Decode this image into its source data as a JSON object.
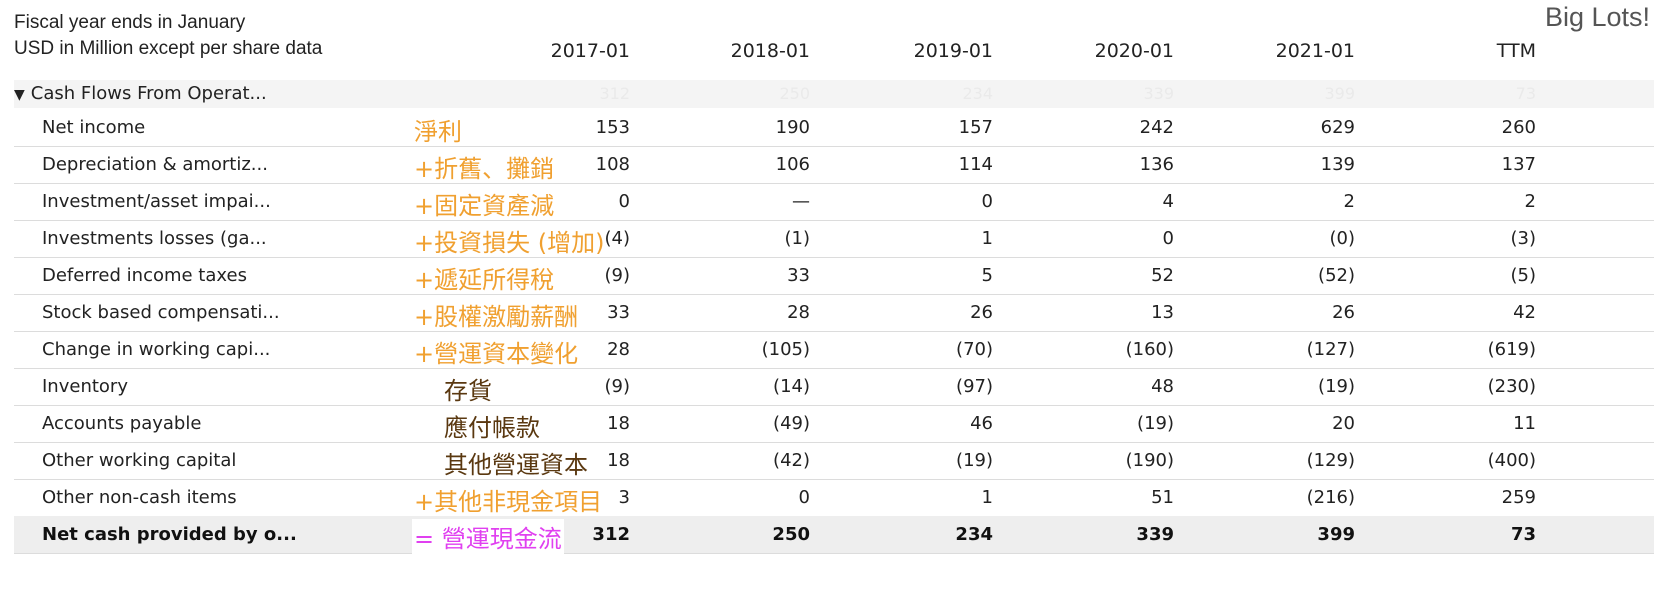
{
  "brand": "Big Lots!",
  "header": {
    "line1": "Fiscal year ends in January",
    "line2": "USD in Million except per share data",
    "years": [
      "2017-01",
      "2018-01",
      "2019-01",
      "2020-01",
      "2021-01",
      "TTM"
    ]
  },
  "section": {
    "title": "Cash Flows From Operat...",
    "ghost_values": [
      "312",
      "250",
      "234",
      "339",
      "399",
      "73"
    ]
  },
  "rows": [
    {
      "label": "Net income",
      "cn": "淨利",
      "values": [
        "153",
        "190",
        "157",
        "242",
        "629",
        "260"
      ]
    },
    {
      "label": "Depreciation & amortiz...",
      "cn": "+折舊、攤銷",
      "values": [
        "108",
        "106",
        "114",
        "136",
        "139",
        "137"
      ]
    },
    {
      "label": "Investment/asset impai...",
      "cn": "+固定資產減",
      "values": [
        "0",
        "—",
        "0",
        "4",
        "2",
        "2"
      ]
    },
    {
      "label": "Investments losses (ga...",
      "cn": "+投資損失 (增加)",
      "values": [
        "(4)",
        "(1)",
        "1",
        "0",
        "(0)",
        "(3)"
      ]
    },
    {
      "label": "Deferred income taxes",
      "cn": "+遞延所得稅",
      "values": [
        "(9)",
        "33",
        "5",
        "52",
        "(52)",
        "(5)"
      ]
    },
    {
      "label": "Stock based compensati...",
      "cn": "+股權激勵薪酬",
      "values": [
        "33",
        "28",
        "26",
        "13",
        "26",
        "42"
      ]
    },
    {
      "label": "Change in working capi...",
      "cn": "+營運資本變化",
      "values": [
        "28",
        "(105)",
        "(70)",
        "(160)",
        "(127)",
        "(619)"
      ]
    },
    {
      "label": "Inventory",
      "cn": "存貨",
      "values": [
        "(9)",
        "(14)",
        "(97)",
        "48",
        "(19)",
        "(230)"
      ]
    },
    {
      "label": "Accounts payable",
      "cn": "應付帳款",
      "values": [
        "18",
        "(49)",
        "46",
        "(19)",
        "20",
        "11"
      ]
    },
    {
      "label": "Other working capital",
      "cn": "其他營運資本",
      "values": [
        "18",
        "(42)",
        "(19)",
        "(190)",
        "(129)",
        "(400)"
      ]
    },
    {
      "label": "Other non-cash items",
      "cn": "+其他非現金項目",
      "values": [
        "3",
        "0",
        "1",
        "51",
        "(216)",
        "259"
      ]
    },
    {
      "label": "Net cash provided by o...",
      "cn": "= 營運現金流",
      "values": [
        "312",
        "250",
        "234",
        "339",
        "399",
        "73"
      ]
    }
  ]
}
